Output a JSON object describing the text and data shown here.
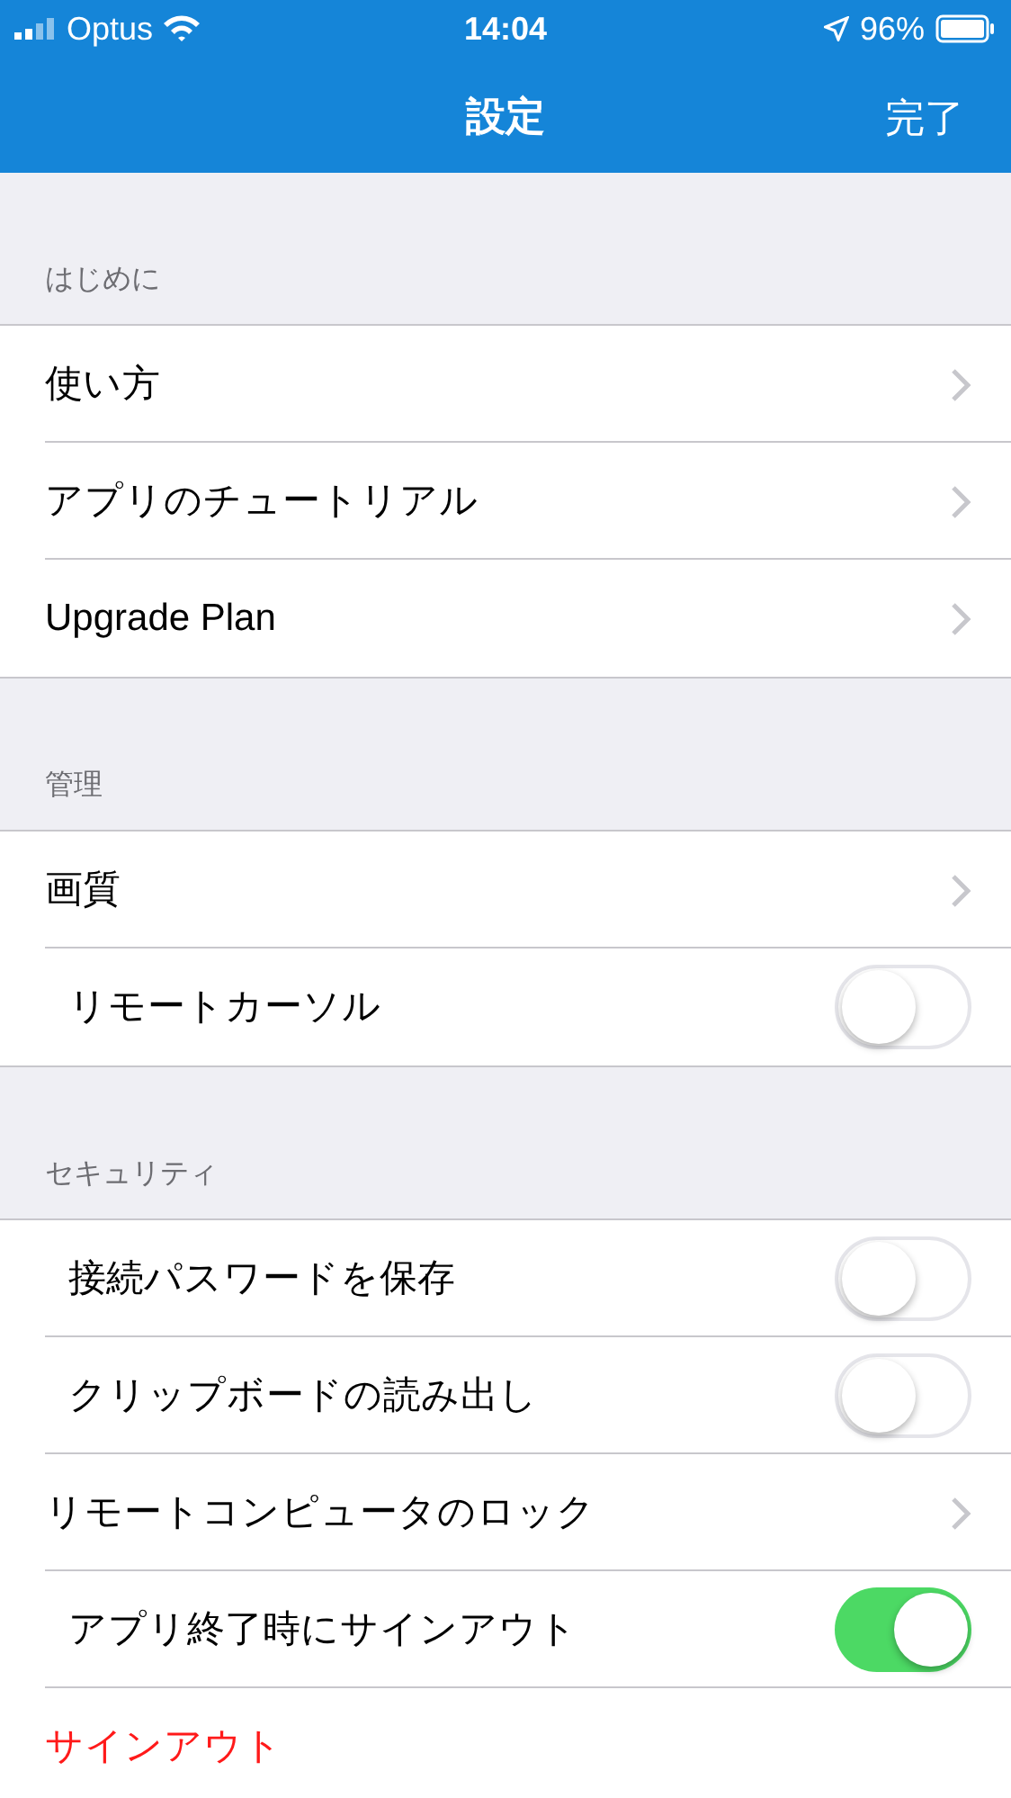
{
  "status_bar": {
    "carrier": "Optus",
    "time": "14:04",
    "battery": "96%"
  },
  "nav": {
    "title": "設定",
    "done": "完了"
  },
  "sections": [
    {
      "header": "はじめに",
      "rows": [
        {
          "kind": "link",
          "label": "使い方"
        },
        {
          "kind": "link",
          "label": "アプリのチュートリアル"
        },
        {
          "kind": "link",
          "label": "Upgrade Plan"
        }
      ]
    },
    {
      "header": "管理",
      "rows": [
        {
          "kind": "link",
          "label": "画質"
        },
        {
          "kind": "toggle",
          "label": "リモートカーソル",
          "on": false
        }
      ]
    },
    {
      "header": "セキュリティ",
      "rows": [
        {
          "kind": "toggle",
          "label": "接続パスワードを保存",
          "on": false
        },
        {
          "kind": "toggle",
          "label": "クリップボードの読み出し",
          "on": false
        },
        {
          "kind": "link",
          "label": "リモートコンピュータのロック"
        },
        {
          "kind": "toggle",
          "label": "アプリ終了時にサインアウト",
          "on": true
        },
        {
          "kind": "action",
          "label": "サインアウト"
        }
      ]
    }
  ]
}
